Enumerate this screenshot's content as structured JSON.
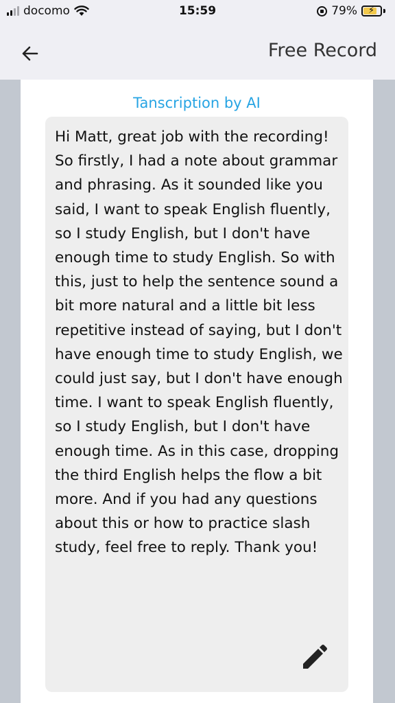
{
  "status_bar": {
    "carrier": "docomo",
    "time": "15:59",
    "battery": "79%",
    "battery_level": 0.79,
    "signal_bars": 2,
    "icons": [
      "signal-icon",
      "wifi-icon",
      "orientation-lock-icon",
      "battery-charging-icon"
    ]
  },
  "nav": {
    "title": "Free Record",
    "back_icon": "arrow-left-icon"
  },
  "content": {
    "heading": "Tanscription by AI",
    "transcript": "Hi Matt, great job with the recording! So firstly, I had a note about grammar and phrasing. As it sounded like you said, I want to speak English fluently, so I study English, but I don't have enough time to study English. So with this, just to help the sentence sound a bit more natural and a little bit less repetitive instead of saying, but I don't have enough time to study English, we could just say, but I don't have enough time. I want to speak English fluently, so I study English, but I don't have enough time. As in this case, dropping the third English helps the flow a bit more. And if you had any questions about this or how to practice slash study, feel free to reply. Thank you!",
    "edit_icon": "pencil-icon"
  },
  "colors": {
    "accent": "#27a4e3",
    "nav_background": "#efeff4",
    "side_background": "#c2c8d0",
    "transcript_background": "#eeeeee",
    "battery": "#f2c94c"
  }
}
